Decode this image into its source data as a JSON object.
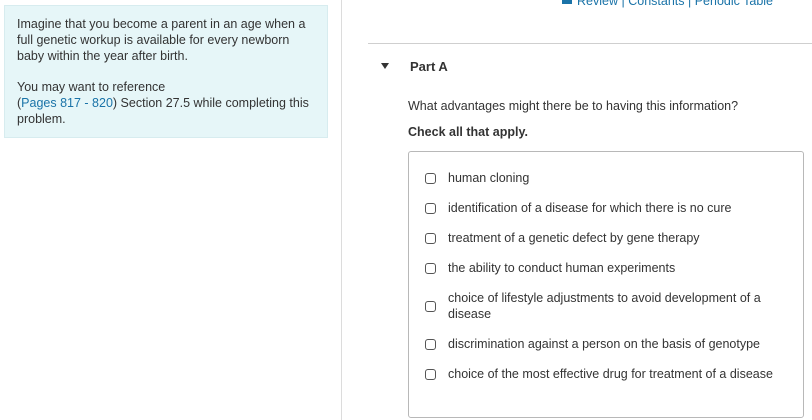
{
  "top_links": {
    "review": "Review",
    "separator": "|",
    "constants": "Constants",
    "periodic_table": "Periodic Table"
  },
  "info_panel": {
    "intro": "Imagine that you become a parent in an age when a full genetic workup is available for every newborn baby within the year after birth.",
    "reference_prefix": "You may want to reference",
    "reference_open": "(",
    "reference_link": "Pages 817 - 820",
    "reference_suffix": ") Section 27.5 while completing this problem."
  },
  "part": {
    "title": "Part A",
    "question": "What advantages might there be to having this information?",
    "instruction": "Check all that apply."
  },
  "options": [
    {
      "label": "human cloning"
    },
    {
      "label": "identification of a disease for which there is no cure"
    },
    {
      "label": "treatment of a genetic defect by gene therapy"
    },
    {
      "label": "the ability to conduct human experiments"
    },
    {
      "label": "choice of lifestyle adjustments to avoid development of a disease"
    },
    {
      "label": "discrimination against a person on the basis of genotype"
    },
    {
      "label": "choice of the most effective drug for treatment of a disease"
    }
  ],
  "colors": {
    "accent": "#1a73a8",
    "panel_bg": "#e6f6f8"
  }
}
